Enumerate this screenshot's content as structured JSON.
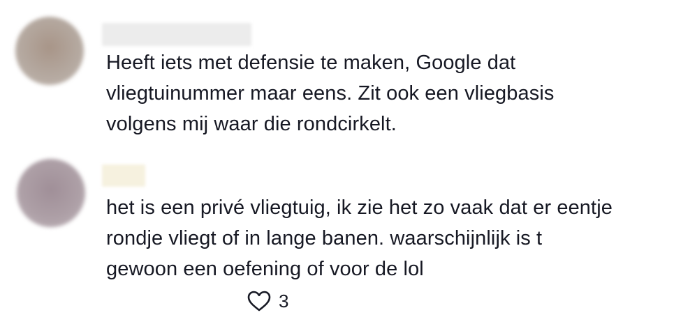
{
  "colors": {
    "text": "#161823",
    "avatar_1": "#b0a49a",
    "avatar_2": "#ab9ca3",
    "name_blur_1": "#ececec",
    "name_blur_2": "#f6f1df",
    "heart_stroke": "#161823"
  },
  "comments": [
    {
      "name": "",
      "text": "Heeft iets met defensie te maken, Google dat\nvliegtuinummer maar eens. Zit ook een vliegbasis\nvolgens mij waar die rondcirkelt."
    },
    {
      "name": "",
      "text": "het is een privé vliegtuig, ik zie het zo vaak dat er eentje\nrondje vliegt of in lange banen. waarschijnlijk is t\ngewoon een oefening of voor de lol",
      "like_icon": "heart-outline-icon",
      "like_count": "3"
    }
  ]
}
